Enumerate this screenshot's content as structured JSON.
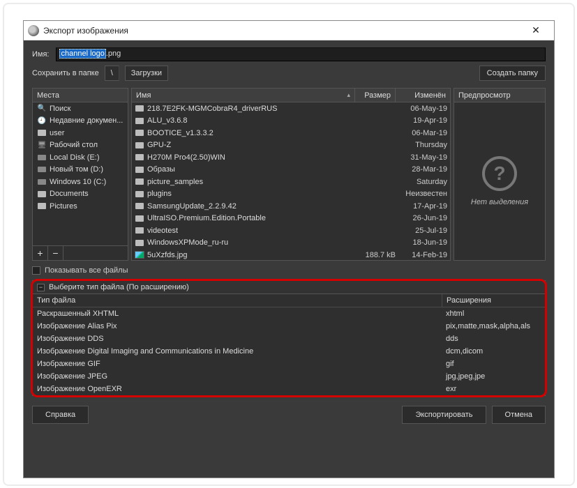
{
  "window": {
    "title": "Экспорт изображения",
    "close": "✕"
  },
  "name_label": "Имя:",
  "filename_selected": "channel logo",
  "filename_ext": ".png",
  "save_in_label": "Сохранить в папке",
  "path_root": "\\",
  "path_folder": "Загрузки",
  "create_folder": "Создать папку",
  "places_header": "Места",
  "files_header": {
    "name": "Имя",
    "size": "Размер",
    "modified": "Изменён"
  },
  "preview_header": "Предпросмотр",
  "preview_empty": "Нет выделения",
  "places": [
    {
      "icon": "search",
      "label": "Поиск"
    },
    {
      "icon": "recent",
      "label": "Недавние докумен..."
    },
    {
      "icon": "folder",
      "label": "user"
    },
    {
      "icon": "desktop",
      "label": "Рабочий стол"
    },
    {
      "icon": "drive",
      "label": "Local Disk (E:)"
    },
    {
      "icon": "drive",
      "label": "Новый том (D:)"
    },
    {
      "icon": "drive",
      "label": "Windows 10 (C:)"
    },
    {
      "icon": "folder",
      "label": "Documents"
    },
    {
      "icon": "folder",
      "label": "Pictures"
    }
  ],
  "files": [
    {
      "icon": "folder",
      "name": "218.7E2FK-MGMCobraR4_driverRUS",
      "size": "",
      "mod": "06-May-19"
    },
    {
      "icon": "folder",
      "name": "ALU_v3.6.8",
      "size": "",
      "mod": "19-Apr-19"
    },
    {
      "icon": "folder",
      "name": "BOOTICE_v1.3.3.2",
      "size": "",
      "mod": "06-Mar-19"
    },
    {
      "icon": "folder",
      "name": "GPU-Z",
      "size": "",
      "mod": "Thursday"
    },
    {
      "icon": "folder",
      "name": "H270M Pro4(2.50)WIN",
      "size": "",
      "mod": "31-May-19"
    },
    {
      "icon": "folder",
      "name": "Образы",
      "size": "",
      "mod": "28-Mar-19"
    },
    {
      "icon": "folder",
      "name": "picture_samples",
      "size": "",
      "mod": "Saturday"
    },
    {
      "icon": "folder",
      "name": "plugins",
      "size": "",
      "mod": "Неизвестен"
    },
    {
      "icon": "folder",
      "name": "SamsungUpdate_2.2.9.42",
      "size": "",
      "mod": "17-Apr-19"
    },
    {
      "icon": "folder",
      "name": "UltraISO.Premium.Edition.Portable",
      "size": "",
      "mod": "26-Jun-19"
    },
    {
      "icon": "folder",
      "name": "videotest",
      "size": "",
      "mod": "25-Jul-19"
    },
    {
      "icon": "folder",
      "name": "WindowsXPMode_ru-ru",
      "size": "",
      "mod": "18-Jun-19"
    },
    {
      "icon": "image",
      "name": "5uXzfds.jpg",
      "size": "188.7 kB",
      "mod": "14-Feb-19"
    }
  ],
  "show_all": "Показывать все файлы",
  "type_header": "Выберите тип файла (По расширению)",
  "type_cols": {
    "type": "Тип файла",
    "ext": "Расширения"
  },
  "types": [
    {
      "name": "Раскрашенный XHTML",
      "ext": "xhtml"
    },
    {
      "name": "Изображение Alias Pix",
      "ext": "pix,matte,mask,alpha,als"
    },
    {
      "name": "Изображение DDS",
      "ext": "dds"
    },
    {
      "name": "Изображение Digital Imaging and Communications in Medicine",
      "ext": "dcm,dicom"
    },
    {
      "name": "Изображение GIF",
      "ext": "gif"
    },
    {
      "name": "Изображение JPEG",
      "ext": "jpg,jpeg,jpe"
    },
    {
      "name": "Изображение OpenEXR",
      "ext": "exr"
    }
  ],
  "footer": {
    "help": "Справка",
    "export": "Экспортировать",
    "cancel": "Отмена"
  },
  "plus": "+",
  "minus": "−",
  "collapse": "−",
  "caret": "▴"
}
